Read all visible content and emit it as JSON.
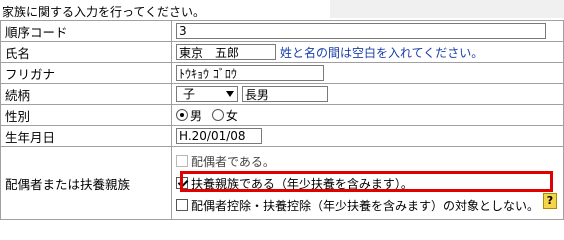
{
  "intro": "家族に関する入力を行ってください。",
  "rows": {
    "order": {
      "label": "順序コード",
      "value": "3"
    },
    "name": {
      "label": "氏名",
      "value": "東京　五郎",
      "hint": "姓と名の間は空白を入れてください。"
    },
    "kana": {
      "label": "フリガナ",
      "value": "ﾄｳｷｮｳ ｺﾞﾛｳ"
    },
    "relation": {
      "label": "続柄",
      "select": "子",
      "value": "長男"
    },
    "gender": {
      "label": "性別",
      "male": "男",
      "female": "女",
      "selected": "男"
    },
    "birth": {
      "label": "生年月日",
      "value": "H.20/01/08"
    },
    "spouse": {
      "label": "配偶者または扶養親族",
      "opt1": "配偶者である。",
      "opt2": "扶養親族である（年少扶養を含みます）。",
      "opt3": "配偶者控除・扶養控除（年少扶養を含みます）の対象としない。",
      "help": "?"
    }
  },
  "colors": {
    "highlight": "#e00000",
    "hint": "#1a3ea8"
  }
}
